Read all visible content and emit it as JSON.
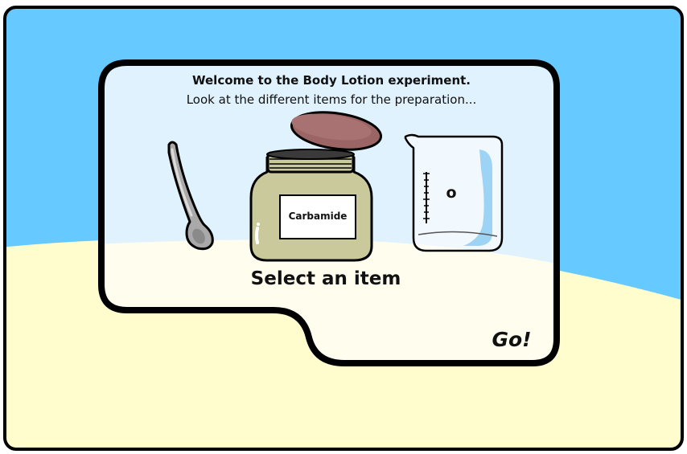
{
  "panel": {
    "welcome_text": "Welcome to the Body Lotion experiment.",
    "subtitle_text": "Look at the different items for the preparation...",
    "select_label": "Select an item",
    "go_label": "Go!"
  },
  "items": {
    "spoon": {
      "icon": "spoon-icon"
    },
    "jar": {
      "icon": "jar-icon",
      "label": "Carbamide"
    },
    "beaker": {
      "icon": "beaker-icon",
      "label": "o"
    }
  },
  "colors": {
    "sky": "#66c9ff",
    "sand": "#fffdcd",
    "panel_top": "#e0f2fd",
    "panel_bottom": "#fffdee",
    "jar_body": "#c9c99b",
    "jar_lid": "#9c6565",
    "outline": "#000000"
  }
}
